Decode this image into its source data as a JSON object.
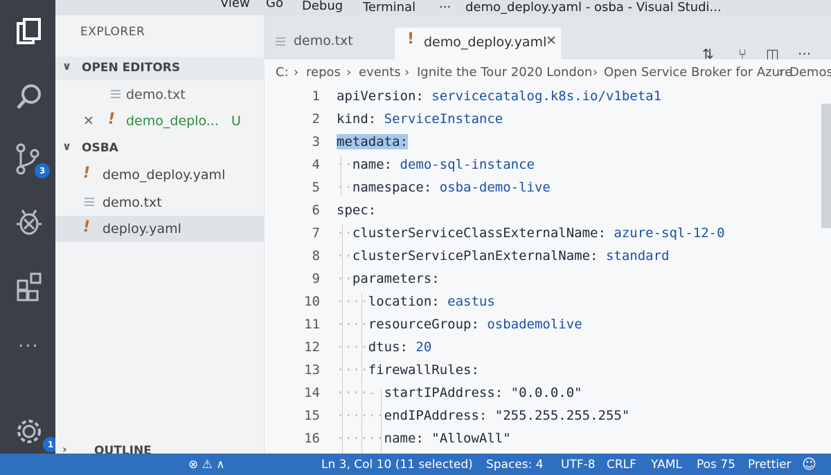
{
  "titlebar": {
    "menu": [
      "View",
      "Go",
      "Debug",
      "Terminal",
      "···"
    ],
    "title": "demo_deploy.yaml - osba - Visual Studi..."
  },
  "activitybar": {
    "scm_badge": "3",
    "settings_badge": "1",
    "more": "···"
  },
  "sidebar": {
    "title": "EXPLORER",
    "open_editors": {
      "header": "OPEN EDITORS",
      "items": [
        {
          "name": "demo.txt",
          "status": ""
        },
        {
          "name": "demo_deplo...",
          "status": "U"
        }
      ]
    },
    "workspace": {
      "header": "OSBA",
      "files": [
        "demo_deploy.yaml",
        "demo.txt",
        "deploy.yaml"
      ]
    },
    "outline": {
      "header": "OUTLINE"
    }
  },
  "tabs": [
    {
      "label": "demo.txt",
      "active": false
    },
    {
      "label": "demo_deploy.yaml",
      "active": true
    }
  ],
  "breadcrumb": [
    "C:",
    "repos",
    "events",
    "Ignite the Tour 2020 London",
    "Open Service Broker for Azure",
    "Demos"
  ],
  "editor": {
    "lines": [
      {
        "n": "1",
        "indent": "",
        "key": "apiVersion:",
        "value": " servicecatalog.k8s.io/v1beta1"
      },
      {
        "n": "2",
        "indent": "",
        "key": "kind:",
        "value": " ServiceInstance"
      },
      {
        "n": "3",
        "indent": "",
        "key": "metadata:",
        "value": ""
      },
      {
        "n": "4",
        "indent": "··",
        "key": "name:",
        "value": " demo-sql-instance"
      },
      {
        "n": "5",
        "indent": "··",
        "key": "namespace:",
        "value": " osba-demo-live"
      },
      {
        "n": "6",
        "indent": "",
        "key": "spec:",
        "value": ""
      },
      {
        "n": "7",
        "indent": "··",
        "key": "clusterServiceClassExternalName:",
        "value": " azure-sql-12-0"
      },
      {
        "n": "8",
        "indent": "··",
        "key": "clusterServicePlanExternalName:",
        "value": " standard"
      },
      {
        "n": "9",
        "indent": "··",
        "key": "parameters:",
        "value": ""
      },
      {
        "n": "10",
        "indent": "····",
        "key": "location:",
        "value": " eastus"
      },
      {
        "n": "11",
        "indent": "····",
        "key": "resourceGroup:",
        "value": " osbademolive"
      },
      {
        "n": "12",
        "indent": "····",
        "key": "dtus:",
        "value": " 20"
      },
      {
        "n": "13",
        "indent": "····",
        "key": "firewallRules:",
        "value": ""
      },
      {
        "n": "14",
        "indent": "····- ",
        "key": "startIPAddress:",
        "value": " \"0.0.0.0\""
      },
      {
        "n": "15",
        "indent": "······",
        "key": "endIPAddress:",
        "value": " \"255.255.255.255\""
      },
      {
        "n": "16",
        "indent": "······",
        "key": "name:",
        "value": " \"AllowAll\""
      }
    ]
  },
  "statusbar": {
    "position": "Ln 3, Col 10 (11 selected)",
    "spaces": "Spaces: 4",
    "encoding": "UTF-8",
    "eol": "CRLF",
    "language": "YAML",
    "pos": "Pos 75",
    "formatter": "Prettier"
  },
  "colors": {
    "activitybar": "#3a3f48",
    "statusbar": "#2f6fbf",
    "badge": "#1e6fd0",
    "modified_green": "#2e8b3c",
    "yaml_icon": "#c26a2a"
  }
}
